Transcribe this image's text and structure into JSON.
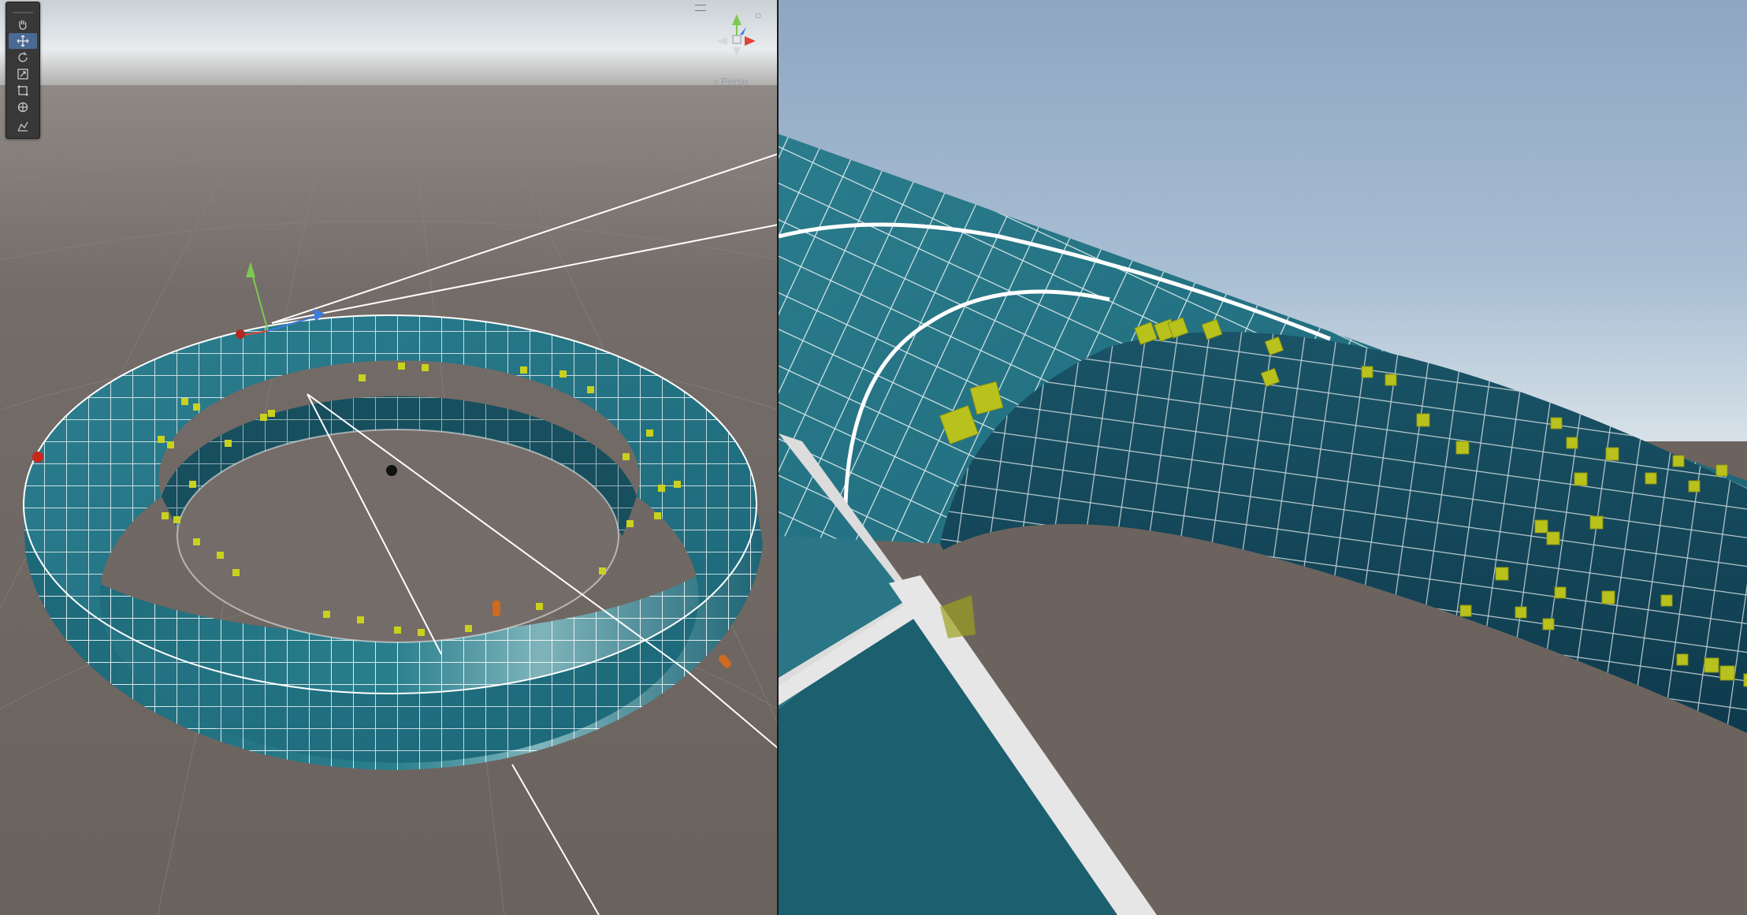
{
  "scene_view": {
    "tools": [
      {
        "name": "hand-tool",
        "active": false
      },
      {
        "name": "move-tool",
        "active": true
      },
      {
        "name": "rotate-tool",
        "active": false
      },
      {
        "name": "scale-tool",
        "active": false
      },
      {
        "name": "rect-tool",
        "active": false
      },
      {
        "name": "transform-tool",
        "active": false
      },
      {
        "name": "custom-editor-tool",
        "active": false
      }
    ],
    "projection_label": "Persp",
    "gizmo_axes": {
      "y": "#7ec850",
      "x": "#e0443a",
      "z": "#3c7be0"
    }
  },
  "colors": {
    "sky_top": "#dfe6ea",
    "ground": "#6e6560",
    "surface": "#1f6e80",
    "surface_dark": "#164f5f",
    "grid_lines": "#ffffff",
    "markers": "#c9d11e",
    "game_sky": "#8fa9c6"
  }
}
